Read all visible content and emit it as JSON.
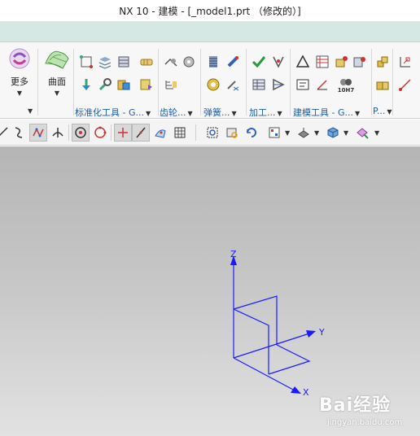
{
  "window": {
    "title": "NX 10 - 建模 - [_model1.prt （修改的）]"
  },
  "ribbon": {
    "more_label": "更多",
    "surface_label": "曲面",
    "groups": [
      {
        "label": "标准化工具 - G..."
      },
      {
        "label": "齿轮..."
      },
      {
        "label": "弹簧..."
      },
      {
        "label": "加工..."
      },
      {
        "label": "建模工具 - G..."
      },
      {
        "label": "P..."
      }
    ],
    "hole_callout": "10H7"
  },
  "viewport": {
    "axis_labels": {
      "z": "Z",
      "y": "Y",
      "x": "X"
    },
    "axis_color": "#1a1aff"
  },
  "watermark": {
    "brand": "Bai经验",
    "url": "jingyan.baidu.com"
  }
}
